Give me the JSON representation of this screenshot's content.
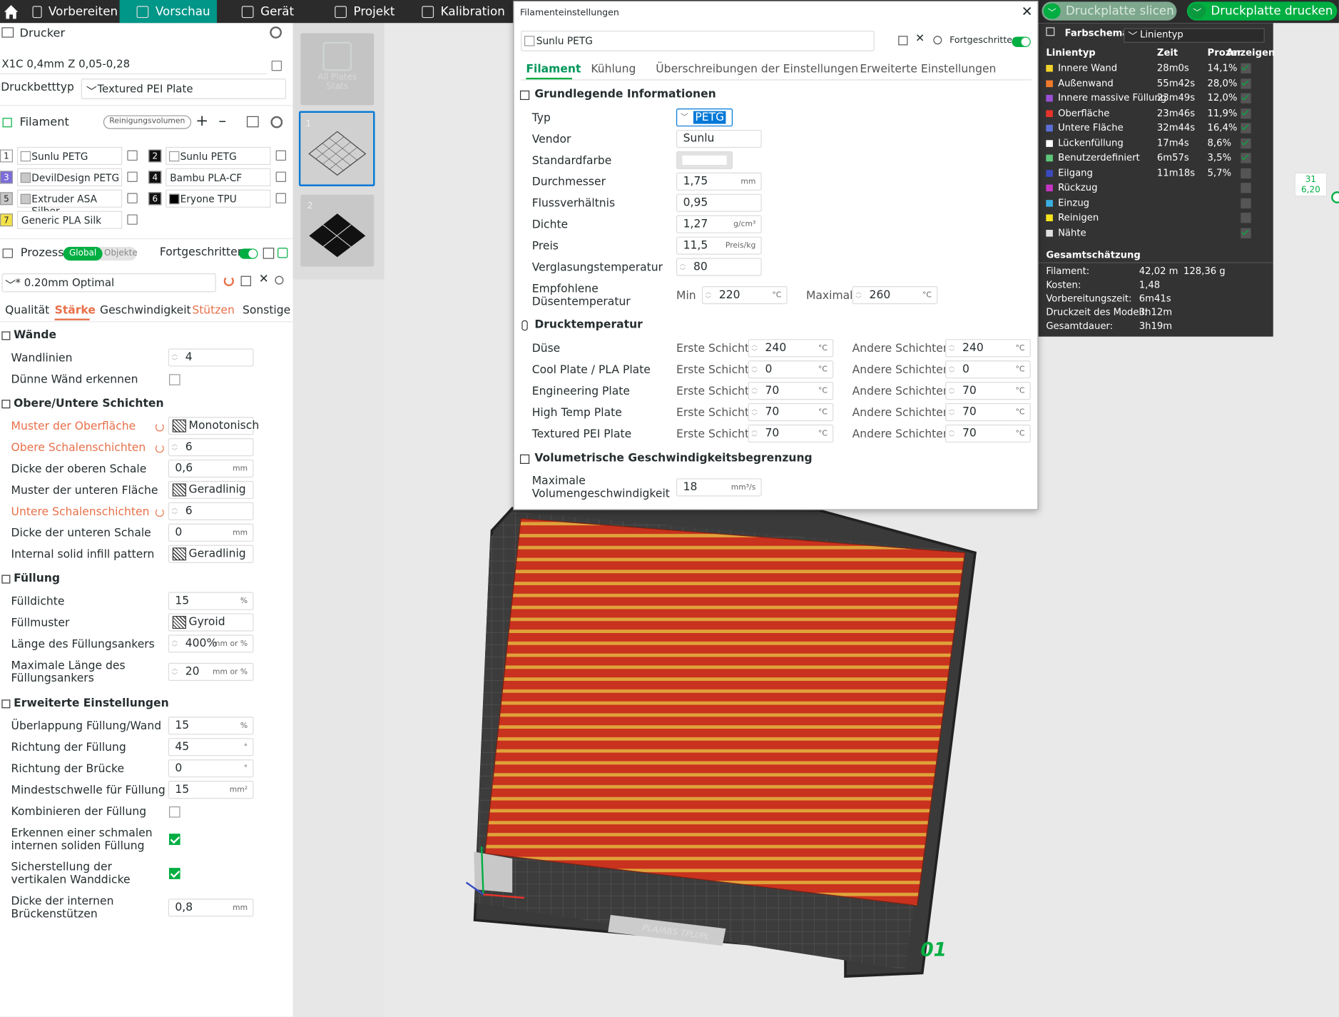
{
  "topbar": {
    "tabs": [
      "Vorbereiten",
      "Vorschau",
      "Gerät",
      "Projekt",
      "Kalibration"
    ],
    "slice": "Druckplatte slicen",
    "print": "Druckplatte drucken"
  },
  "printer": {
    "title": "Drucker",
    "preset": "X1C 0,4mm Z 0,05-0,28",
    "plate_label": "Druckbetttyp",
    "plate": "Textured PEI Plate"
  },
  "filament": {
    "title": "Filament",
    "purge": "Reinigungsvolumen",
    "items": [
      {
        "n": "1",
        "name": "Sunlu PETG",
        "color": "#ffffff",
        "badge": "#ffffff"
      },
      {
        "n": "2",
        "name": "Sunlu PETG",
        "color": "#ffffff",
        "badge": "#111111"
      },
      {
        "n": "3",
        "name": "DevilDesign PETG",
        "color": "#c8c8c8",
        "badge": "#7b6cd9"
      },
      {
        "n": "4",
        "name": "Bambu PLA-CF",
        "color": "",
        "badge": "#111111"
      },
      {
        "n": "5",
        "name": "Extruder ASA Silber",
        "color": "#c8c8c8",
        "badge": "#c8c8c8"
      },
      {
        "n": "6",
        "name": "Eryone TPU",
        "color": "#000000",
        "badge": "#111111"
      },
      {
        "n": "7",
        "name": "Generic PLA Silk",
        "color": "",
        "badge": "#f3e14a"
      }
    ]
  },
  "process": {
    "title": "Prozess",
    "global": "Global",
    "objects": "Objekte",
    "advanced": "Fortgeschritten",
    "preset": "* 0.20mm Optimal",
    "tabs": [
      "Qualität",
      "Stärke",
      "Geschwindigkeit",
      "Stützen",
      "Sonstige"
    ]
  },
  "walls": {
    "title": "Wände",
    "loops_label": "Wandlinien",
    "loops": "4",
    "thin_label": "Dünne Wänd erkennen"
  },
  "topbottom": {
    "title": "Obere/Untere Schichten",
    "top_pattern_label": "Muster der Oberfläche",
    "top_pattern": "Monotonisch",
    "top_layers_label": "Obere Schalenschichten",
    "top_layers": "6",
    "top_thick_label": "Dicke der oberen Schale",
    "top_thick": "0,6",
    "bottom_pattern_label": "Muster der unteren Fläche",
    "bottom_pattern": "Geradlinig",
    "bottom_layers_label": "Untere Schalenschichten",
    "bottom_layers": "6",
    "bottom_thick_label": "Dicke der unteren Schale",
    "bottom_thick": "0",
    "internal_label": "Internal solid infill pattern",
    "internal": "Geradlinig"
  },
  "infill": {
    "title": "Füllung",
    "density_label": "Fülldichte",
    "density": "15",
    "pattern_label": "Füllmuster",
    "pattern": "Gyroid",
    "anchor_label": "Länge des Füllungsankers",
    "anchor": "400%",
    "anchor_max_label": "Maximale Länge des Füllungsankers",
    "anchor_max": "20"
  },
  "advanced": {
    "title": "Erweiterte Einstellungen",
    "overlap_label": "Überlappung Füllung/Wand",
    "overlap": "15",
    "dir_label": "Richtung der Füllung",
    "dir": "45",
    "bridge_label": "Richtung der Brücke",
    "bridge": "0",
    "min_label": "Mindestschwelle für Füllung",
    "min": "15",
    "combine_label": "Kombinieren der Füllung",
    "narrow_label": "Erkennen einer schmalen internen soliden Füllung",
    "vertical_label": "Sicherstellung der vertikalen Wanddicke",
    "bridge_sup_label": "Dicke der internen Brückenstützen",
    "bridge_sup": "0,8"
  },
  "units": {
    "pct": "%",
    "mm": "mm",
    "mmpct": "mm or %",
    "deg": "°",
    "mm2": "mm²",
    "gcm3": "g/cm³",
    "price": "Preis/kg",
    "c": "°C",
    "vol": "mm³/s"
  },
  "thumbs": {
    "all": "All Plates Stats",
    "p1": "1",
    "p2": "2"
  },
  "dialog": {
    "title": "Filamenteinstellungen",
    "preset": "Sunlu PETG",
    "advanced": "Fortgeschritten",
    "tabs": [
      "Filament",
      "Kühlung",
      "Überschreibungen der Einstellungen",
      "Erweiterte Einstellungen"
    ],
    "basic": "Grundlegende Informationen",
    "type_label": "Typ",
    "type": "PETG",
    "vendor_label": "Vendor",
    "vendor": "Sunlu",
    "color_label": "Standardfarbe",
    "diam_label": "Durchmesser",
    "diam": "1,75",
    "flow_label": "Flussverhältnis",
    "flow": "0,95",
    "density_label": "Dichte",
    "density": "1,27",
    "price_label": "Preis",
    "price": "11,5",
    "glass_label": "Verglasungstemperatur",
    "glass": "80",
    "nozzle_rec_label": "Empfohlene Düsentemperatur",
    "min_label": "Min",
    "min": "220",
    "max_label": "Maximal",
    "max": "260",
    "print_temp": "Drucktemperatur",
    "first": "Erste Schicht",
    "other": "Andere Schichten",
    "temps": [
      {
        "label": "Düse",
        "a": "240",
        "b": "240"
      },
      {
        "label": "Cool Plate / PLA Plate",
        "a": "0",
        "b": "0"
      },
      {
        "label": "Engineering Plate",
        "a": "70",
        "b": "70"
      },
      {
        "label": "High Temp Plate",
        "a": "70",
        "b": "70"
      },
      {
        "label": "Textured PEI Plate",
        "a": "70",
        "b": "70"
      }
    ],
    "volumetric": "Volumetrische Geschwindigkeitsbegrenzung",
    "maxvol_label": "Maximale Volumengeschwindigkeit",
    "maxvol": "18"
  },
  "stats": {
    "title": "Farbschema",
    "type": "Linientyp",
    "h_type": "Linientyp",
    "h_time": "Zeit",
    "h_pct": "Prozent",
    "h_show": "Anzeigen",
    "rows": [
      {
        "n": "Innere Wand",
        "t": "28m0s",
        "p": "14,1%",
        "c": "#f2d32b",
        "on": true
      },
      {
        "n": "Außenwand",
        "t": "55m42s",
        "p": "28,0%",
        "c": "#f07a2c",
        "on": true
      },
      {
        "n": "Innere massive Füllung",
        "t": "23m49s",
        "p": "12,0%",
        "c": "#9b4fd4",
        "on": true
      },
      {
        "n": "Oberfläche",
        "t": "23m46s",
        "p": "11,9%",
        "c": "#e8332a",
        "on": true
      },
      {
        "n": "Untere Fläche",
        "t": "32m44s",
        "p": "16,4%",
        "c": "#5b6fd6",
        "on": true
      },
      {
        "n": "Lückenfüllung",
        "t": "17m4s",
        "p": "8,6%",
        "c": "#ffffff",
        "on": true
      },
      {
        "n": "Benutzerdefiniert",
        "t": "6m57s",
        "p": "3,5%",
        "c": "#5ec77a",
        "on": true
      },
      {
        "n": "Eilgang",
        "t": "11m18s",
        "p": "5,7%",
        "c": "#3a4bc0",
        "on": false
      },
      {
        "n": "Rückzug",
        "t": "",
        "p": "",
        "c": "#c435c4",
        "on": false
      },
      {
        "n": "Einzug",
        "t": "",
        "p": "",
        "c": "#3ab0e0",
        "on": false
      },
      {
        "n": "Reinigen",
        "t": "",
        "p": "",
        "c": "#f6e51c",
        "on": false
      },
      {
        "n": "Nähte",
        "t": "",
        "p": "",
        "c": "#e0e0e0",
        "on": true
      }
    ],
    "total": "Gesamtschätzung",
    "fil_label": "Filament:",
    "fil": "42,02 m",
    "fil_g": "128,36 g",
    "cost_label": "Kosten:",
    "cost": "1,48",
    "prep_label": "Vorbereitungszeit:",
    "prep": "6m41s",
    "model_label": "Druckzeit des Modell:",
    "model": "3h12m",
    "total_label": "Gesamtdauer:",
    "total_v": "3h19m"
  },
  "layer": {
    "top": "31",
    "bottom": "6,20"
  },
  "plate_num": "01",
  "plate_text": "PLA/ABS TPU/PL"
}
